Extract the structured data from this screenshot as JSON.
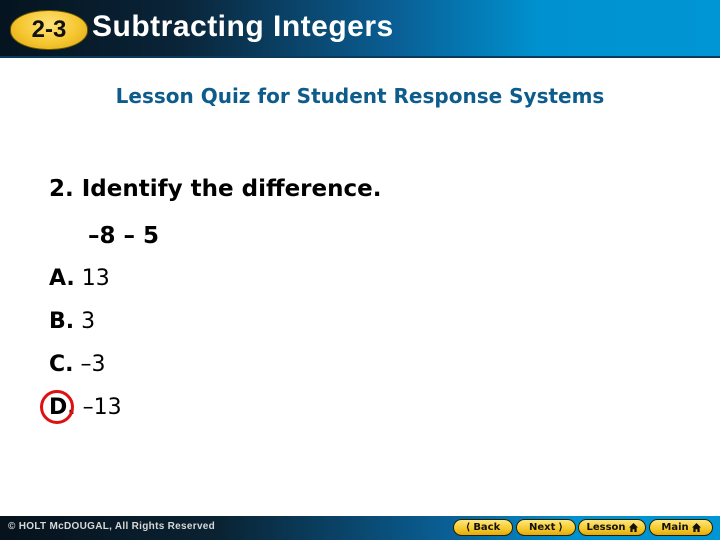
{
  "header": {
    "lesson_number": "2-3",
    "title": "Subtracting Integers"
  },
  "subtitle": "Lesson Quiz for Student Response Systems",
  "question": {
    "prompt": "2. Identify the difference.",
    "expression": "–8 – 5"
  },
  "choices": [
    {
      "letter": "A.",
      "value": "13",
      "selected": false
    },
    {
      "letter": "B.",
      "value": "3",
      "selected": false
    },
    {
      "letter": "C.",
      "value": "–3",
      "selected": false
    },
    {
      "letter": "D.",
      "value": "–13",
      "selected": true
    }
  ],
  "footer": {
    "copyright": "© HOLT McDOUGAL, All Rights Reserved",
    "nav": {
      "back": "Back",
      "next": "Next",
      "lesson": "Lesson",
      "main": "Main"
    },
    "icons": {
      "back": "chevron-left-icon",
      "next": "chevron-right-icon",
      "lesson": "home-icon",
      "main": "home-icon"
    }
  },
  "colors": {
    "subtitle": "#0d5c8c",
    "badge": "#f5c62f",
    "answer_circle": "#e01010",
    "header_blue": "#0095d4"
  }
}
